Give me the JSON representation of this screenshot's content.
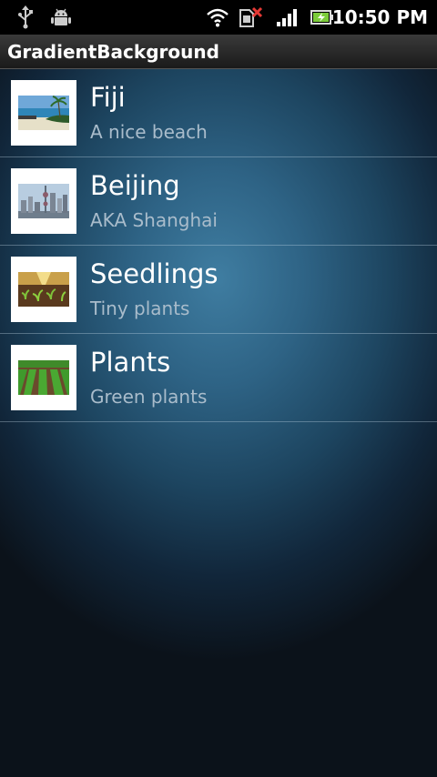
{
  "status_bar": {
    "time": "10:50 PM",
    "icons": [
      "usb-icon",
      "android-debug-icon",
      "wifi-icon",
      "sim-error-icon",
      "signal-icon",
      "battery-charging-icon"
    ],
    "colors": {
      "background": "#000000",
      "sim_error": "#e53935",
      "battery": "#7ccc3a"
    }
  },
  "title_bar": {
    "title": "GradientBackground"
  },
  "list": {
    "items": [
      {
        "title": "Fiji",
        "subtitle": "A nice beach",
        "thumbnail": "beach-image"
      },
      {
        "title": "Beijing",
        "subtitle": "AKA Shanghai",
        "thumbnail": "city-skyline-image"
      },
      {
        "title": "Seedlings",
        "subtitle": "Tiny plants",
        "thumbnail": "seedlings-image"
      },
      {
        "title": "Plants",
        "subtitle": "Green plants",
        "thumbnail": "plant-rows-image"
      }
    ]
  },
  "colors": {
    "gradient_center": "#3f7da1",
    "gradient_edge": "#0b121a",
    "title_text": "#ffffff",
    "subtitle_text": "#a9bccb"
  }
}
